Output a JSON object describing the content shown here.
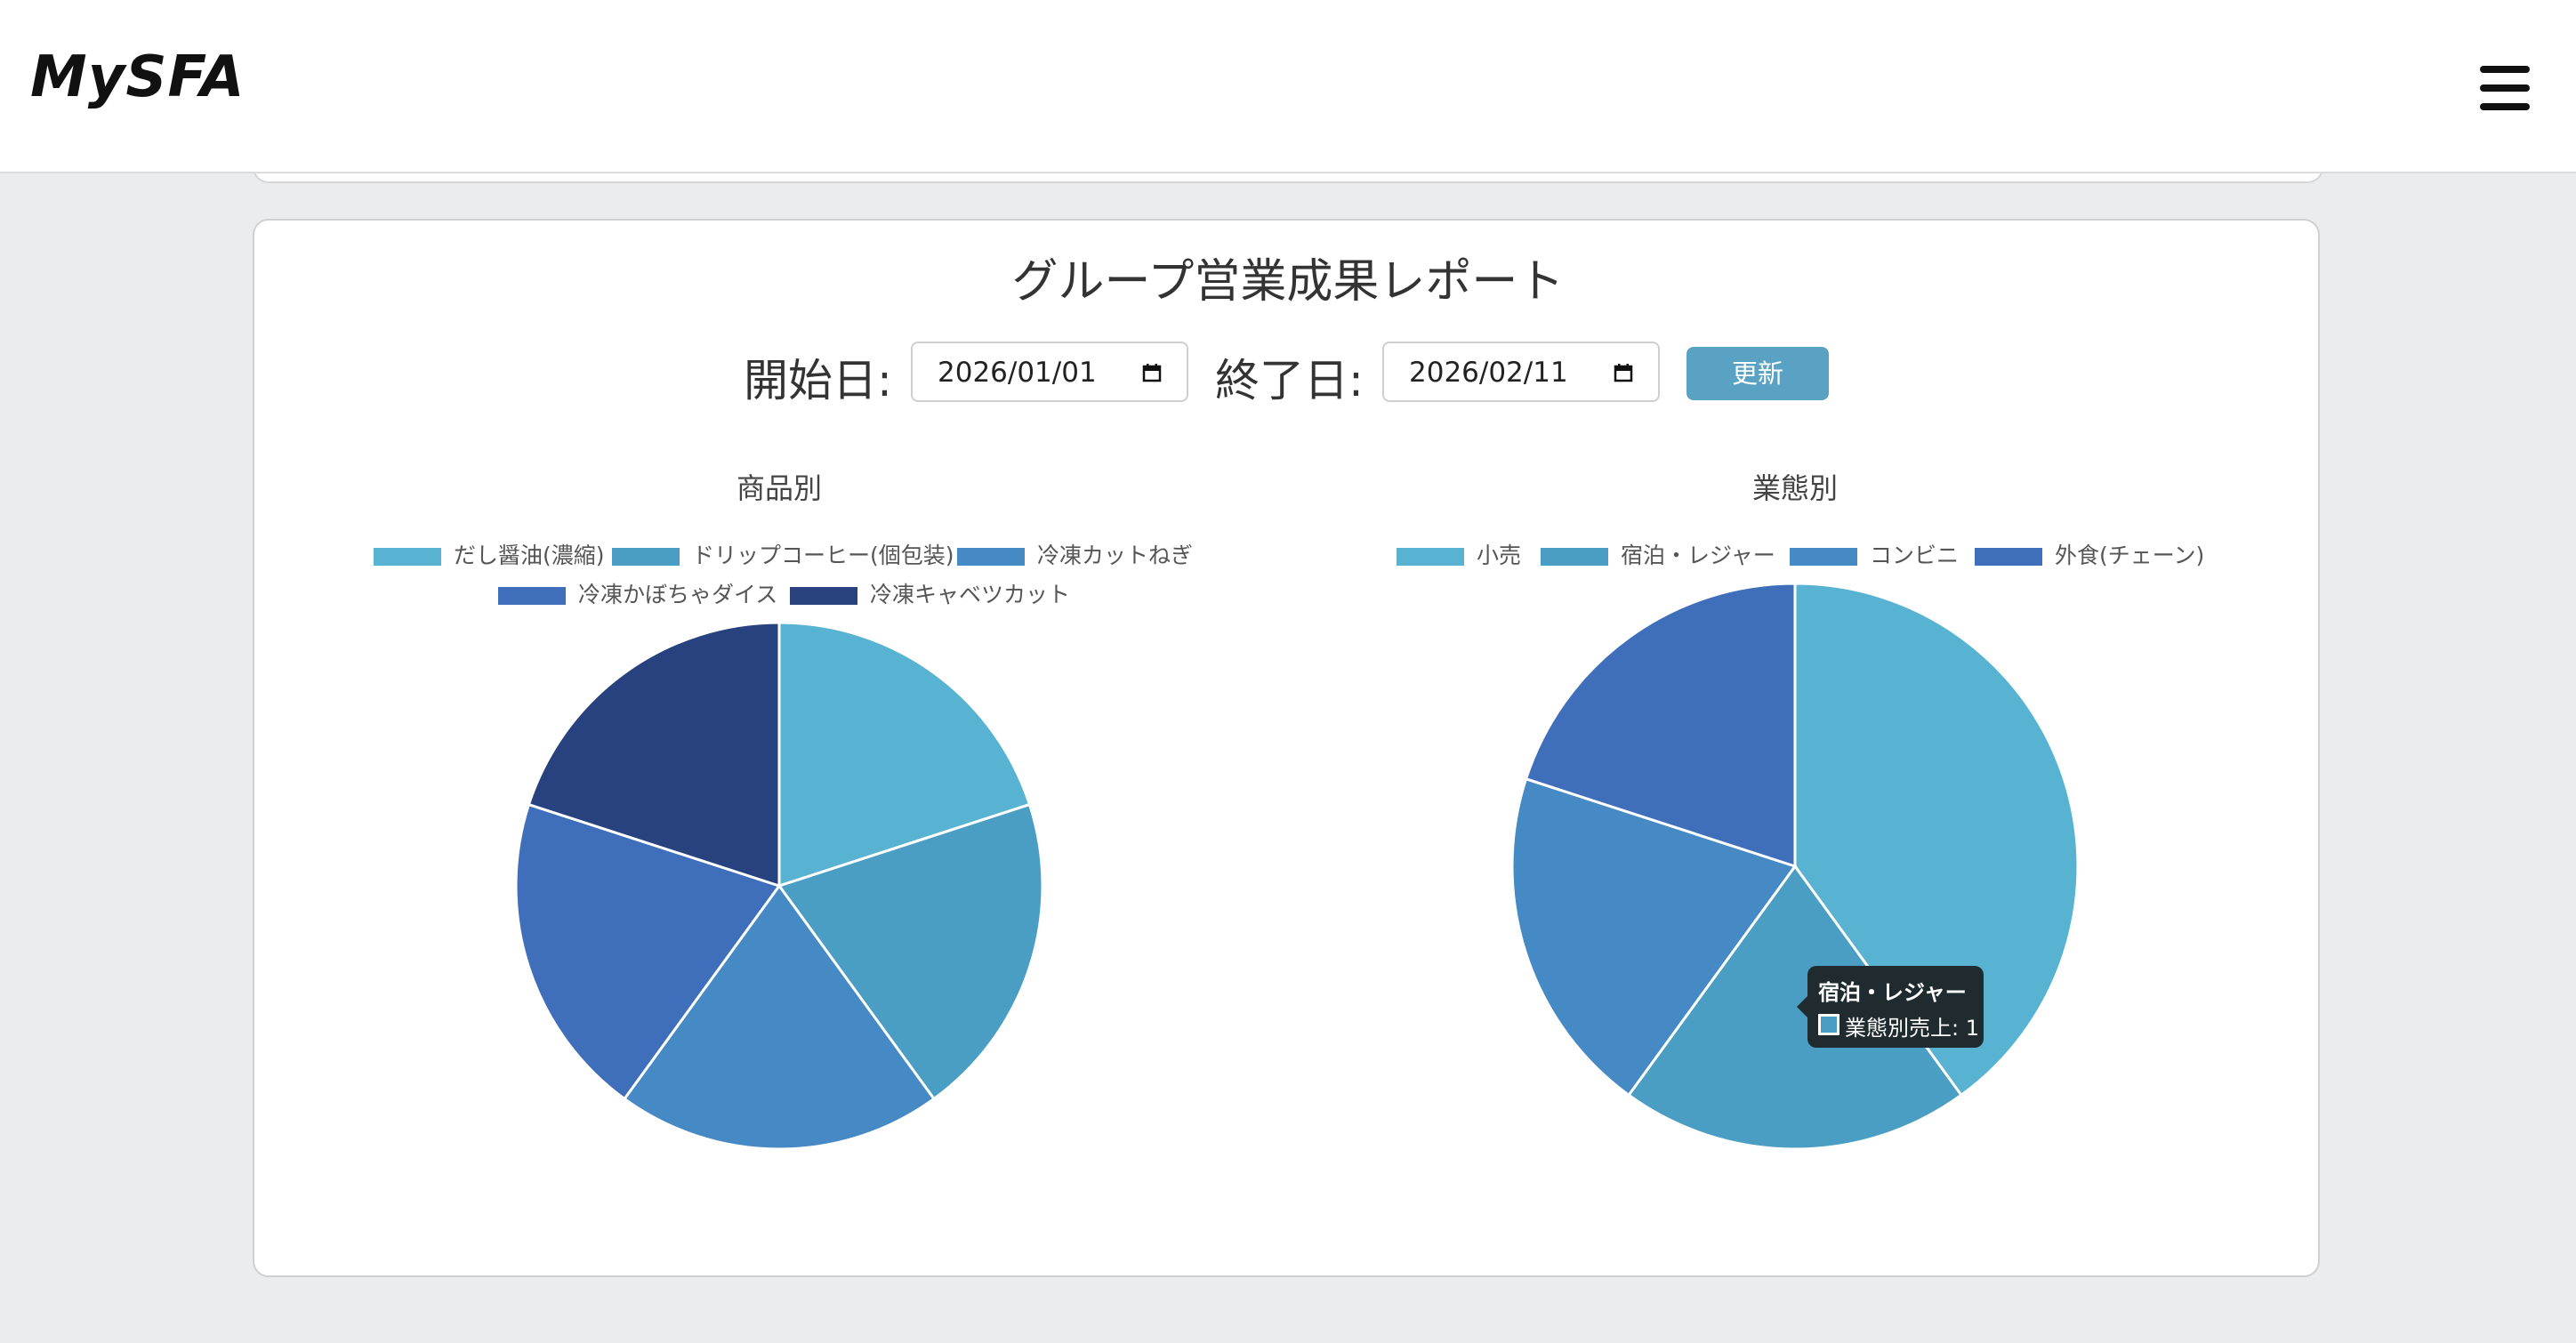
{
  "app": {
    "logo": "MySFA"
  },
  "report": {
    "title": "グループ営業成果レポート",
    "start_label": "開始日:",
    "start_value": "2026/01/01",
    "end_label": "終了日:",
    "end_value": "2026/02/11",
    "update_label": "更新"
  },
  "tooltip": {
    "title": "宿泊・レジャー",
    "text": "業態別売上: 1"
  },
  "chart_data": [
    {
      "type": "pie",
      "title": "商品別",
      "categories": [
        "だし醤油(濃縮)",
        "ドリップコーヒー(個包装)",
        "冷凍カットねぎ",
        "冷凍かぼちゃダイス",
        "冷凍キャベツカット"
      ],
      "values": [
        1,
        1,
        1,
        1,
        1
      ],
      "colors": [
        "#58b2d1",
        "#4a9ec4",
        "#4589c5",
        "#3f6fbb",
        "#27427e"
      ],
      "legend": "top"
    },
    {
      "type": "pie",
      "title": "業態別",
      "categories": [
        "小売",
        "宿泊・レジャー",
        "コンビニ",
        "外食(チェーン)"
      ],
      "values": [
        2,
        1,
        1,
        1
      ],
      "colors": [
        "#58b2d1",
        "#4a9ec4",
        "#4589c5",
        "#3f6fbb"
      ],
      "legend": "top"
    }
  ]
}
